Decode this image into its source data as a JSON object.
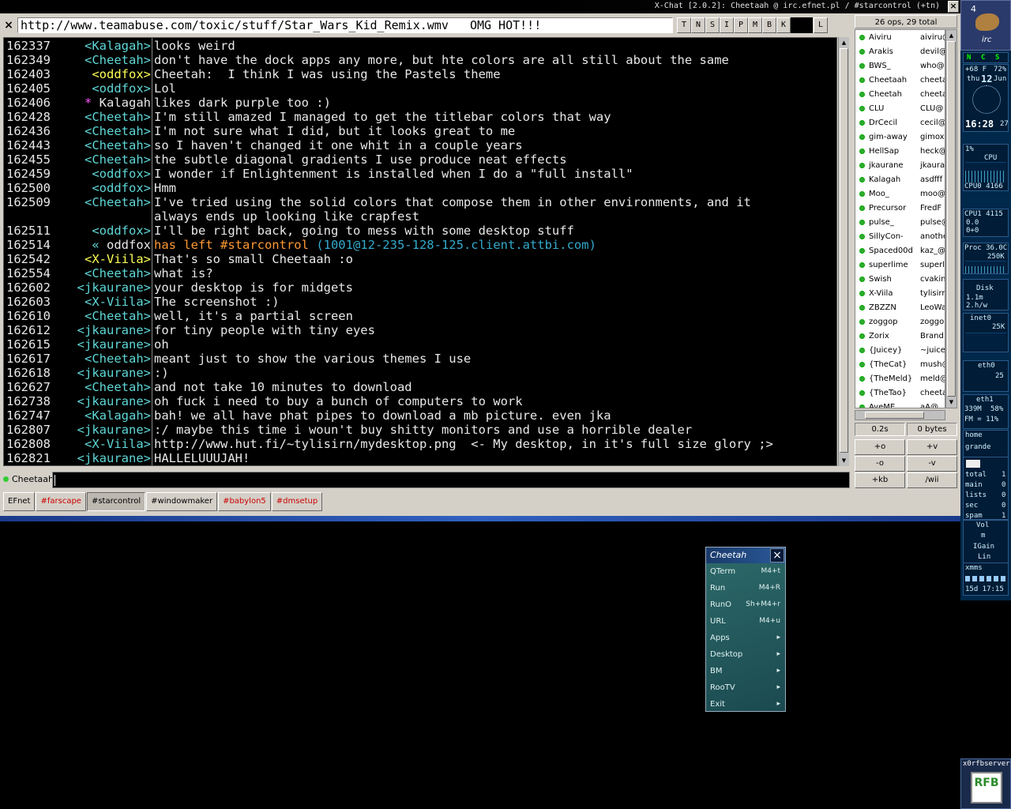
{
  "window": {
    "title": "X-Chat [2.0.2]: Cheetaah @ irc.efnet.pl / #starcontrol (+tn)"
  },
  "topic": {
    "close": "×",
    "text": "http://www.teamabuse.com/toxic/stuff/Star_Wars_Kid_Remix.wmv   OMG HOT!!!"
  },
  "modes": [
    "T",
    "N",
    "S",
    "I",
    "P",
    "M",
    "B",
    "K",
    "L"
  ],
  "messages": [
    {
      "ts": "162337",
      "nick": "<Kalagah>",
      "text": "looks weird",
      "nc": "#5fd7d7",
      "tc": "#e8e8e8"
    },
    {
      "ts": "162349",
      "nick": "<Cheetah>",
      "text": "don't have the dock apps any more, but hte colors are all still about the same",
      "nc": "#5fd7d7",
      "tc": "#e8e8e8"
    },
    {
      "ts": "162403",
      "nick": "<oddfox>",
      "text": "Cheetah:  I think I was using the Pastels theme",
      "nc": "#ffff55",
      "tc": "#e8e8e8"
    },
    {
      "ts": "162405",
      "nick": "<oddfox>",
      "text": "Lol",
      "nc": "#5fd7d7",
      "tc": "#e8e8e8"
    },
    {
      "ts": "162406",
      "nick": "* Kalagah",
      "text": "likes dark purple too :)",
      "nc": "#e8e8e8",
      "tc": "#e8e8e8",
      "star": true
    },
    {
      "ts": "162428",
      "nick": "<Cheetah>",
      "text": "I'm still amazed I managed to get the titlebar colors that way",
      "nc": "#5fd7d7",
      "tc": "#e8e8e8"
    },
    {
      "ts": "162436",
      "nick": "<Cheetah>",
      "text": "I'm not sure what I did, but it looks great to me",
      "nc": "#5fd7d7",
      "tc": "#e8e8e8"
    },
    {
      "ts": "162443",
      "nick": "<Cheetah>",
      "text": "so I haven't changed it one whit in a couple years",
      "nc": "#5fd7d7",
      "tc": "#e8e8e8"
    },
    {
      "ts": "162455",
      "nick": "<Cheetah>",
      "text": "the subtle diagonal gradients I use produce neat effects",
      "nc": "#5fd7d7",
      "tc": "#e8e8e8"
    },
    {
      "ts": "162459",
      "nick": "<oddfox>",
      "text": "I wonder if Enlightenment is installed when I do a \"full install\"",
      "nc": "#5fd7d7",
      "tc": "#e8e8e8"
    },
    {
      "ts": "162500",
      "nick": "<oddfox>",
      "text": "Hmm",
      "nc": "#5fd7d7",
      "tc": "#e8e8e8"
    },
    {
      "ts": "162509",
      "nick": "<Cheetah>",
      "text": "I've tried using the solid colors that compose them in other environments, and it",
      "nc": "#5fd7d7",
      "tc": "#e8e8e8"
    },
    {
      "ts": "",
      "nick": "",
      "text": "always ends up looking like crapfest",
      "nc": "#5fd7d7",
      "tc": "#e8e8e8"
    },
    {
      "ts": "162511",
      "nick": "<oddfox>",
      "text": "I'll be right back, going to mess with some desktop stuff",
      "nc": "#5fd7d7",
      "tc": "#e8e8e8"
    },
    {
      "ts": "162514",
      "nick": "« oddfox",
      "text": "has left #starcontrol ",
      "extra": "(1001@12-235-128-125.client.attbi.com)",
      "nc": "#e8e8e8",
      "tc": "#ff9933",
      "quit": true
    },
    {
      "ts": "162542",
      "nick": "<X-Viila>",
      "text": "That's so small Cheetaah :o",
      "nc": "#ffff55",
      "tc": "#e8e8e8"
    },
    {
      "ts": "162554",
      "nick": "<Cheetah>",
      "text": "what is?",
      "nc": "#5fd7d7",
      "tc": "#e8e8e8"
    },
    {
      "ts": "162602",
      "nick": "<jkaurane>",
      "text": "your desktop is for midgets",
      "nc": "#5fd7d7",
      "tc": "#e8e8e8"
    },
    {
      "ts": "162603",
      "nick": "<X-Viila>",
      "text": "The screenshot :)",
      "nc": "#5fd7d7",
      "tc": "#e8e8e8"
    },
    {
      "ts": "162610",
      "nick": "<Cheetah>",
      "text": "well, it's a partial screen",
      "nc": "#5fd7d7",
      "tc": "#e8e8e8"
    },
    {
      "ts": "162612",
      "nick": "<jkaurane>",
      "text": "for tiny people with tiny eyes",
      "nc": "#5fd7d7",
      "tc": "#e8e8e8"
    },
    {
      "ts": "162615",
      "nick": "<jkaurane>",
      "text": "oh",
      "nc": "#5fd7d7",
      "tc": "#e8e8e8"
    },
    {
      "ts": "162617",
      "nick": "<Cheetah>",
      "text": "meant just to show the various themes I use",
      "nc": "#5fd7d7",
      "tc": "#e8e8e8"
    },
    {
      "ts": "162618",
      "nick": "<jkaurane>",
      "text": ":)",
      "nc": "#5fd7d7",
      "tc": "#e8e8e8"
    },
    {
      "ts": "162627",
      "nick": "<Cheetah>",
      "text": "and not take 10 minutes to download",
      "nc": "#5fd7d7",
      "tc": "#e8e8e8"
    },
    {
      "ts": "162738",
      "nick": "<jkaurane>",
      "text": "oh fuck i need to buy a bunch of computers to work",
      "nc": "#5fd7d7",
      "tc": "#e8e8e8"
    },
    {
      "ts": "162747",
      "nick": "<Kalagah>",
      "text": "bah! we all have phat pipes to download a mb picture. even jka",
      "nc": "#5fd7d7",
      "tc": "#e8e8e8"
    },
    {
      "ts": "162807",
      "nick": "<jkaurane>",
      "text": ":/ maybe this time i woun't buy shitty monitors and use a horrible dealer",
      "nc": "#5fd7d7",
      "tc": "#e8e8e8"
    },
    {
      "ts": "162808",
      "nick": "<X-Viila>",
      "text": "http://www.hut.fi/~tylisirn/mydesktop.png  <- My desktop, in it's full size glory ;>",
      "nc": "#5fd7d7",
      "tc": "#e8e8e8"
    },
    {
      "ts": "162821",
      "nick": "<jkaurane>",
      "text": "HALLELUUUJAH!",
      "nc": "#5fd7d7",
      "tc": "#e8e8e8"
    }
  ],
  "input": {
    "nick": "Cheetaah"
  },
  "tabs": [
    {
      "label": "EFnet",
      "red": false,
      "active": false
    },
    {
      "label": "#farscape",
      "red": true,
      "active": false
    },
    {
      "label": "#starcontrol",
      "red": false,
      "active": true
    },
    {
      "label": "#windowmaker",
      "red": false,
      "active": false
    },
    {
      "label": "#babylon5",
      "red": true,
      "active": false
    },
    {
      "label": "#dmsetup",
      "red": true,
      "active": false
    }
  ],
  "userlist": {
    "header": "26 ops, 29 total",
    "users": [
      {
        "n": "Aiviru",
        "h": "aiviru@"
      },
      {
        "n": "Arakis",
        "h": "devil@"
      },
      {
        "n": "BWS_",
        "h": "who@"
      },
      {
        "n": "Cheetaah",
        "h": "cheeta"
      },
      {
        "n": "Cheetah",
        "h": "cheeta"
      },
      {
        "n": "CLU",
        "h": "CLU@"
      },
      {
        "n": "DrCecil",
        "h": "cecil@"
      },
      {
        "n": "gim-away",
        "h": "gimox"
      },
      {
        "n": "HellSap",
        "h": "heck@"
      },
      {
        "n": "jkaurane",
        "h": "jkaurar"
      },
      {
        "n": "Kalagah",
        "h": "asdfff"
      },
      {
        "n": "Moo_",
        "h": "moo@"
      },
      {
        "n": "Precursor",
        "h": "FredF"
      },
      {
        "n": "pulse_",
        "h": "pulse@"
      },
      {
        "n": "SillyCon-",
        "h": "anothe"
      },
      {
        "n": "Spaced00d",
        "h": "kaz_@"
      },
      {
        "n": "superlime",
        "h": "superli"
      },
      {
        "n": "Swish",
        "h": "cvakin"
      },
      {
        "n": "X-Viila",
        "h": "tylisirr"
      },
      {
        "n": "ZBZZN",
        "h": "LeoWa"
      },
      {
        "n": "zoggop",
        "h": "zoggo"
      },
      {
        "n": "Zorix",
        "h": "Brand"
      },
      {
        "n": "{Juicey}",
        "h": "~juicey"
      },
      {
        "n": "{TheCat}",
        "h": "mush@"
      },
      {
        "n": "{TheMeld}",
        "h": "meld@"
      },
      {
        "n": "{TheTao}",
        "h": "cheeta"
      },
      {
        "n": "AyeME",
        "h": "aA@"
      }
    ],
    "lag": "0.2s",
    "bytes": "0 bytes",
    "buttons": [
      "+o",
      "+v",
      "-o",
      "-v",
      "+kb",
      "/wii"
    ]
  },
  "dock": {
    "workspace": "4",
    "irc_label": "irc",
    "wm_btns": [
      "N",
      "C",
      "S"
    ],
    "temp": "+68 F",
    "temp_pct": "72%",
    "day": "thu",
    "date": "12",
    "month": "Jun",
    "time": "16:28",
    "secs": "27",
    "cpu_pct": "1%",
    "cpu": "CPU",
    "cpu0": "CPU0 4166",
    "cpu1": "CPU1 4115",
    "cpu1_a": "0.0",
    "cpu1_b": "0+0",
    "proc": "Proc 36.0C",
    "proc_k": "250K",
    "disk": "Disk",
    "disk_a": "1.1m",
    "disk_b": "2.h/w",
    "inet0": "inet0",
    "inet0_k": "25K",
    "eth0": "eth0",
    "eth0_n": "25",
    "eth1": "eth1",
    "eth1_a": "339M",
    "eth1_b": "58%",
    "eth1_c": "FM = 11%",
    "home": "home",
    "grande": "grande",
    "mail": [
      {
        "l": "total",
        "v": "1"
      },
      {
        "l": "main",
        "v": "0"
      },
      {
        "l": "lists",
        "v": "0"
      },
      {
        "l": "sec",
        "v": "0"
      },
      {
        "l": "spam",
        "v": "1"
      }
    ],
    "vol": "Vol",
    "m": "m",
    "igain": "IGain",
    "line": "Lin",
    "xmms": "xmms",
    "uptime": "15d 17:15",
    "rfb_label": "x0rfbserver",
    "rfb": "RFB"
  },
  "menu": {
    "title": "Cheetah",
    "items": [
      {
        "l": "QTerm",
        "k": "M4+t"
      },
      {
        "l": "Run",
        "k": "M4+R"
      },
      {
        "l": "RunO",
        "k": "Sh+M4+r"
      },
      {
        "l": "URL",
        "k": "M4+u"
      },
      {
        "l": "Apps",
        "k": "▸"
      },
      {
        "l": "Desktop",
        "k": "▸"
      },
      {
        "l": "BM",
        "k": "▸"
      },
      {
        "l": "RooTV",
        "k": "▸"
      },
      {
        "l": "Exit",
        "k": "▸"
      }
    ]
  }
}
